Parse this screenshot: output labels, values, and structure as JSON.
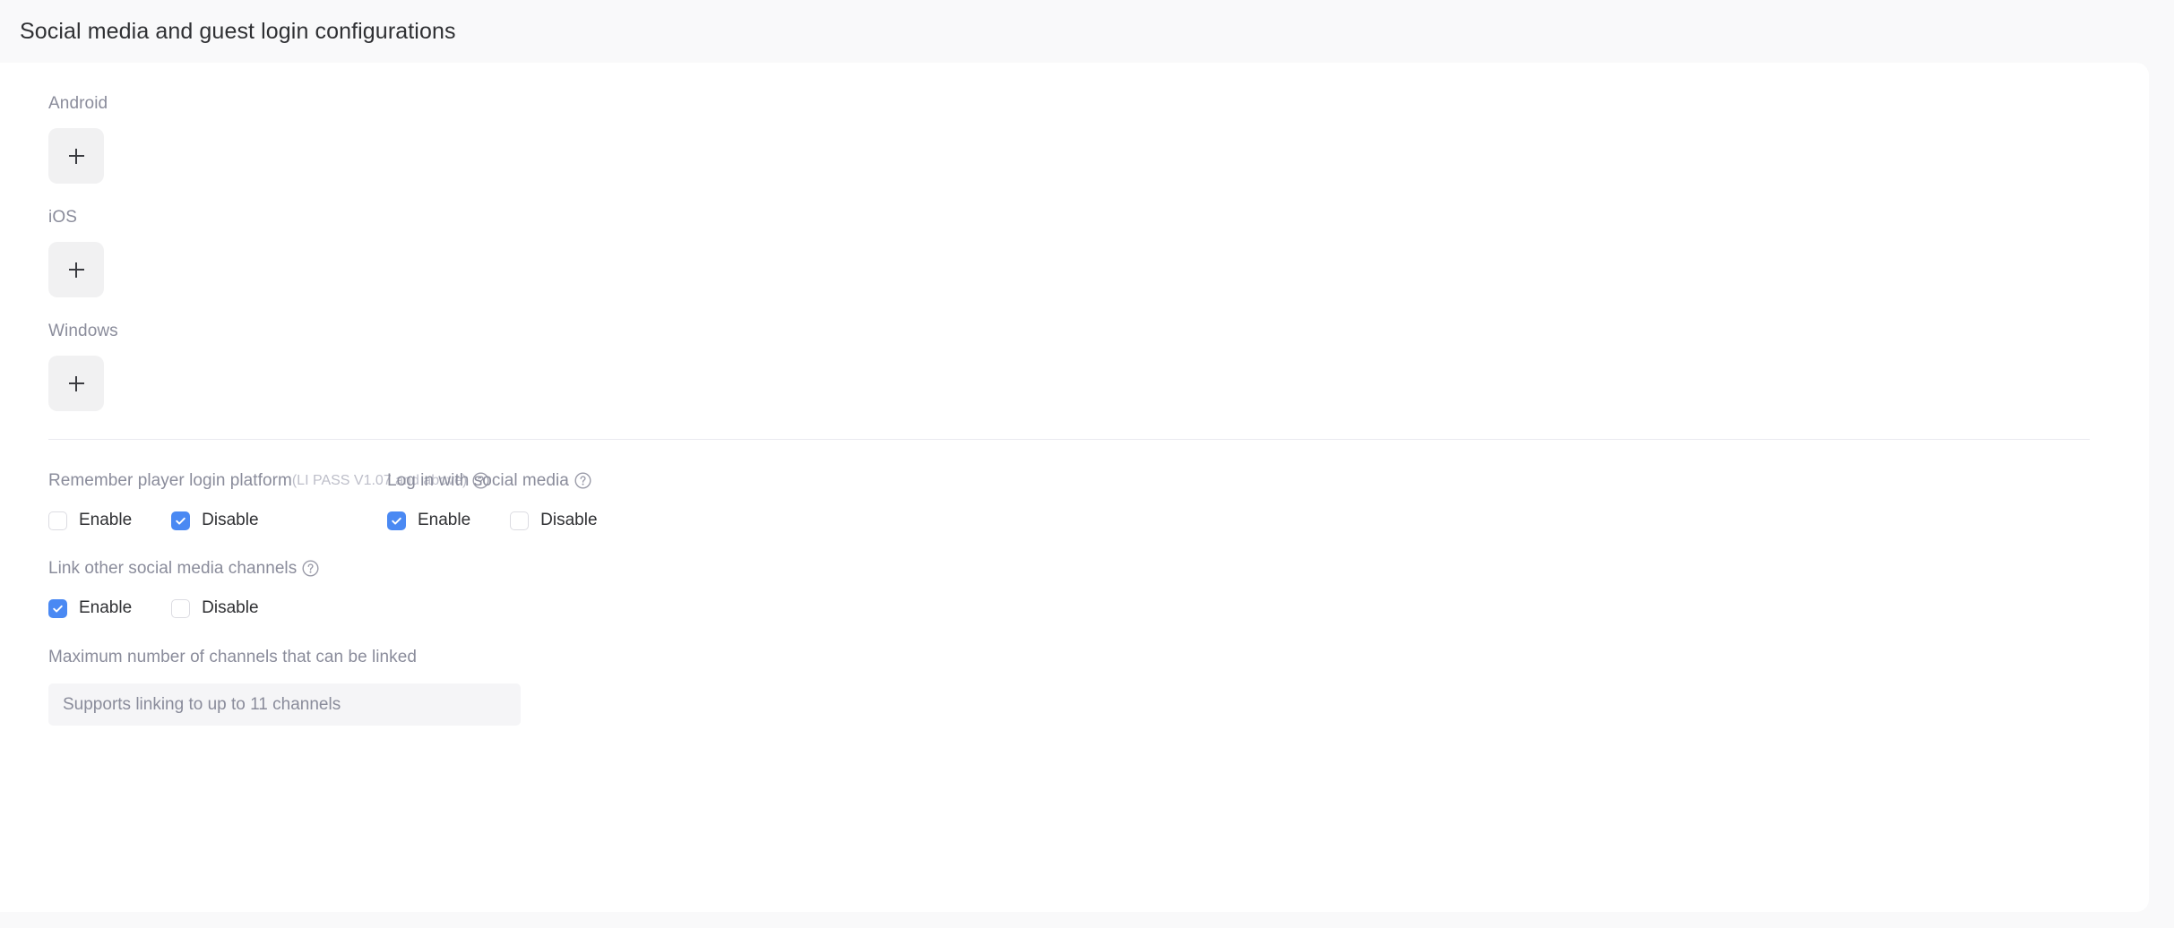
{
  "header": {
    "title": "Social media and guest login configurations"
  },
  "colors": {
    "accent": "#4a89f3",
    "page_background": "#f9f9fa",
    "card_background": "#ffffff",
    "label_text": "#8a8c9b",
    "body_text": "#2f3033",
    "add_button_background": "#f1f1f2",
    "input_background": "#f5f5f7",
    "divider": "#eaeaf0"
  },
  "platforms": [
    {
      "label": "Android",
      "add_button_icon": "plus-icon",
      "add_button_label": "+"
    },
    {
      "label": "iOS",
      "add_button_icon": "plus-icon",
      "add_button_label": "+"
    },
    {
      "label": "Windows",
      "add_button_icon": "plus-icon",
      "add_button_label": "+"
    }
  ],
  "options": {
    "remember_login": {
      "label": "Remember player login platform",
      "sub_note": "(LI PASS V1.07 and above)",
      "help_icon": "question-circle-icon",
      "enable_label": "Enable",
      "enable_checked": false,
      "disable_label": "Disable",
      "disable_checked": true
    },
    "social_login": {
      "label": "Log in with social media",
      "help_icon": "question-circle-icon",
      "enable_label": "Enable",
      "enable_checked": true,
      "disable_label": "Disable",
      "disable_checked": false
    },
    "link_channels": {
      "label": "Link other social media channels",
      "help_icon": "question-circle-icon",
      "enable_label": "Enable",
      "enable_checked": true,
      "disable_label": "Disable",
      "disable_checked": false
    }
  },
  "max_channels": {
    "label": "Maximum number of channels that can be linked",
    "placeholder": "Supports linking to up to 11 channels",
    "value": ""
  }
}
